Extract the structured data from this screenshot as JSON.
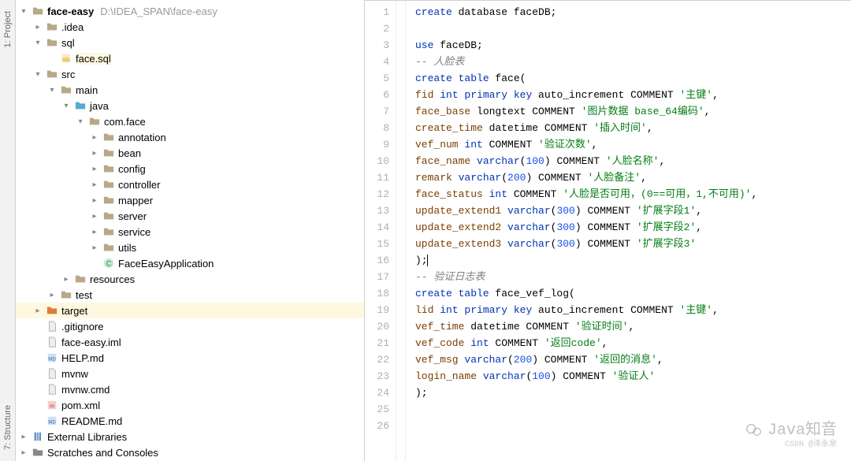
{
  "left_rail": {
    "top": "1: Project",
    "bottom": "7: Structure"
  },
  "project": {
    "root": {
      "name": "face-easy",
      "path": "D:\\IDEA_SPAN\\face-easy"
    },
    "nodes": [
      {
        "d": 1,
        "ar": ">",
        "ic": "dir-dot",
        "nm": ".idea"
      },
      {
        "d": 1,
        "ar": "v",
        "ic": "dir",
        "nm": "sql"
      },
      {
        "d": 2,
        "ar": "",
        "ic": "sql",
        "nm": "face.sql",
        "hl": true
      },
      {
        "d": 1,
        "ar": "v",
        "ic": "dir",
        "nm": "src"
      },
      {
        "d": 2,
        "ar": "v",
        "ic": "dir",
        "nm": "main"
      },
      {
        "d": 3,
        "ar": "v",
        "ic": "dir-blue",
        "nm": "java"
      },
      {
        "d": 4,
        "ar": "v",
        "ic": "pkg",
        "nm": "com.face"
      },
      {
        "d": 5,
        "ar": ">",
        "ic": "pkg",
        "nm": "annotation"
      },
      {
        "d": 5,
        "ar": ">",
        "ic": "pkg",
        "nm": "bean"
      },
      {
        "d": 5,
        "ar": ">",
        "ic": "pkg",
        "nm": "config"
      },
      {
        "d": 5,
        "ar": ">",
        "ic": "pkg",
        "nm": "controller"
      },
      {
        "d": 5,
        "ar": ">",
        "ic": "pkg",
        "nm": "mapper"
      },
      {
        "d": 5,
        "ar": ">",
        "ic": "pkg",
        "nm": "server"
      },
      {
        "d": 5,
        "ar": ">",
        "ic": "pkg",
        "nm": "service"
      },
      {
        "d": 5,
        "ar": ">",
        "ic": "pkg",
        "nm": "utils"
      },
      {
        "d": 5,
        "ar": "",
        "ic": "cls",
        "nm": "FaceEasyApplication"
      },
      {
        "d": 3,
        "ar": ">",
        "ic": "res",
        "nm": "resources"
      },
      {
        "d": 2,
        "ar": ">",
        "ic": "dir",
        "nm": "test"
      },
      {
        "d": 1,
        "ar": ">",
        "ic": "dir-orange",
        "nm": "target",
        "sel": true
      },
      {
        "d": 1,
        "ar": "",
        "ic": "file",
        "nm": ".gitignore"
      },
      {
        "d": 1,
        "ar": "",
        "ic": "file",
        "nm": "face-easy.iml"
      },
      {
        "d": 1,
        "ar": "",
        "ic": "md",
        "nm": "HELP.md"
      },
      {
        "d": 1,
        "ar": "",
        "ic": "file",
        "nm": "mvnw"
      },
      {
        "d": 1,
        "ar": "",
        "ic": "file",
        "nm": "mvnw.cmd"
      },
      {
        "d": 1,
        "ar": "",
        "ic": "mvn",
        "nm": "pom.xml"
      },
      {
        "d": 1,
        "ar": "",
        "ic": "md",
        "nm": "README.md"
      }
    ],
    "footer": [
      {
        "ic": "lib",
        "nm": "External Libraries"
      },
      {
        "ic": "scr",
        "nm": "Scratches and Consoles"
      }
    ]
  },
  "code_lines": [
    [
      {
        "t": "create",
        "c": "kw"
      },
      {
        "t": " database faceDB;",
        "c": "dt"
      }
    ],
    [],
    [
      {
        "t": "use",
        "c": "kw"
      },
      {
        "t": " faceDB;",
        "c": "dt"
      }
    ],
    [
      {
        "t": "-- 人脸表",
        "c": "cm"
      }
    ],
    [
      {
        "t": "create",
        "c": "kw"
      },
      {
        "t": " table ",
        "c": "kw"
      },
      {
        "t": "face(",
        "c": "dt"
      }
    ],
    [
      {
        "t": "fid ",
        "c": "fn"
      },
      {
        "t": "int",
        "c": "kw"
      },
      {
        "t": " primary key ",
        "c": "kw"
      },
      {
        "t": "auto_increment COMMENT ",
        "c": "dt"
      },
      {
        "t": "'主键'",
        "c": "s"
      },
      {
        "t": ",",
        "c": "dt"
      }
    ],
    [
      {
        "t": "face_base ",
        "c": "fn"
      },
      {
        "t": "longtext COMMENT ",
        "c": "dt"
      },
      {
        "t": "'图片数据 base_64编码'",
        "c": "s"
      },
      {
        "t": ",",
        "c": "dt"
      }
    ],
    [
      {
        "t": "create_time ",
        "c": "fn"
      },
      {
        "t": "datetime COMMENT ",
        "c": "dt"
      },
      {
        "t": "'插入时间'",
        "c": "s"
      },
      {
        "t": ",",
        "c": "dt"
      }
    ],
    [
      {
        "t": "vef_num ",
        "c": "fn"
      },
      {
        "t": "int",
        "c": "kw"
      },
      {
        "t": " COMMENT ",
        "c": "dt"
      },
      {
        "t": "'验证次数'",
        "c": "s"
      },
      {
        "t": ",",
        "c": "dt"
      }
    ],
    [
      {
        "t": "face_name ",
        "c": "fn"
      },
      {
        "t": "varchar",
        "c": "kw"
      },
      {
        "t": "(",
        "c": "dt"
      },
      {
        "t": "100",
        "c": "nmbr"
      },
      {
        "t": ") COMMENT ",
        "c": "dt"
      },
      {
        "t": "'人脸名称'",
        "c": "s"
      },
      {
        "t": ",",
        "c": "dt"
      }
    ],
    [
      {
        "t": "remark ",
        "c": "fn"
      },
      {
        "t": "varchar",
        "c": "kw"
      },
      {
        "t": "(",
        "c": "dt"
      },
      {
        "t": "200",
        "c": "nmbr"
      },
      {
        "t": ") COMMENT ",
        "c": "dt"
      },
      {
        "t": "'人脸备注'",
        "c": "s"
      },
      {
        "t": ",",
        "c": "dt"
      }
    ],
    [
      {
        "t": "face_status ",
        "c": "fn"
      },
      {
        "t": "int",
        "c": "kw"
      },
      {
        "t": " COMMENT ",
        "c": "dt"
      },
      {
        "t": "'人脸是否可用，(0==可用，1,不可用)'",
        "c": "s"
      },
      {
        "t": ",",
        "c": "dt"
      }
    ],
    [
      {
        "t": "update_extend1 ",
        "c": "fn"
      },
      {
        "t": "varchar",
        "c": "kw"
      },
      {
        "t": "(",
        "c": "dt"
      },
      {
        "t": "300",
        "c": "nmbr"
      },
      {
        "t": ") COMMENT ",
        "c": "dt"
      },
      {
        "t": "'扩展字段1'",
        "c": "s"
      },
      {
        "t": ",",
        "c": "dt"
      }
    ],
    [
      {
        "t": "update_extend2 ",
        "c": "fn"
      },
      {
        "t": "varchar",
        "c": "kw"
      },
      {
        "t": "(",
        "c": "dt"
      },
      {
        "t": "300",
        "c": "nmbr"
      },
      {
        "t": ") COMMENT ",
        "c": "dt"
      },
      {
        "t": "'扩展字段2'",
        "c": "s"
      },
      {
        "t": ",",
        "c": "dt"
      }
    ],
    [
      {
        "t": "update_extend3 ",
        "c": "fn"
      },
      {
        "t": "varchar",
        "c": "kw"
      },
      {
        "t": "(",
        "c": "dt"
      },
      {
        "t": "300",
        "c": "nmbr"
      },
      {
        "t": ") COMMENT ",
        "c": "dt"
      },
      {
        "t": "'扩展字段3'",
        "c": "s"
      }
    ],
    [
      {
        "t": ");",
        "c": "dt"
      },
      {
        "t": "",
        "c": "dt",
        "cur": true
      }
    ],
    [
      {
        "t": "-- 验证日志表",
        "c": "cm"
      }
    ],
    [
      {
        "t": "create",
        "c": "kw"
      },
      {
        "t": " table ",
        "c": "kw"
      },
      {
        "t": "face_vef_log(",
        "c": "dt"
      }
    ],
    [
      {
        "t": "lid ",
        "c": "fn"
      },
      {
        "t": "int",
        "c": "kw"
      },
      {
        "t": " primary key ",
        "c": "kw"
      },
      {
        "t": "auto_increment COMMENT ",
        "c": "dt"
      },
      {
        "t": "'主键'",
        "c": "s"
      },
      {
        "t": ",",
        "c": "dt"
      }
    ],
    [
      {
        "t": "vef_time ",
        "c": "fn"
      },
      {
        "t": "datetime COMMENT ",
        "c": "dt"
      },
      {
        "t": "'验证时间'",
        "c": "s"
      },
      {
        "t": ",",
        "c": "dt"
      }
    ],
    [
      {
        "t": "vef_code ",
        "c": "fn"
      },
      {
        "t": "int",
        "c": "kw"
      },
      {
        "t": " COMMENT ",
        "c": "dt"
      },
      {
        "t": "'返回code'",
        "c": "s"
      },
      {
        "t": ",",
        "c": "dt"
      }
    ],
    [
      {
        "t": "vef_msg ",
        "c": "fn"
      },
      {
        "t": "varchar",
        "c": "kw"
      },
      {
        "t": "(",
        "c": "dt"
      },
      {
        "t": "200",
        "c": "nmbr"
      },
      {
        "t": ") COMMENT ",
        "c": "dt"
      },
      {
        "t": "'返回的消息'",
        "c": "s"
      },
      {
        "t": ",",
        "c": "dt"
      }
    ],
    [
      {
        "t": "login_name ",
        "c": "fn"
      },
      {
        "t": "varchar",
        "c": "kw"
      },
      {
        "t": "(",
        "c": "dt"
      },
      {
        "t": "100",
        "c": "nmbr"
      },
      {
        "t": ") COMMENT ",
        "c": "dt"
      },
      {
        "t": "'验证人'",
        "c": "s"
      }
    ],
    [
      {
        "t": ");",
        "c": "dt"
      }
    ],
    [],
    []
  ],
  "watermark": {
    "main": "Java知音",
    "sub": "CSDN @泽永泉"
  }
}
